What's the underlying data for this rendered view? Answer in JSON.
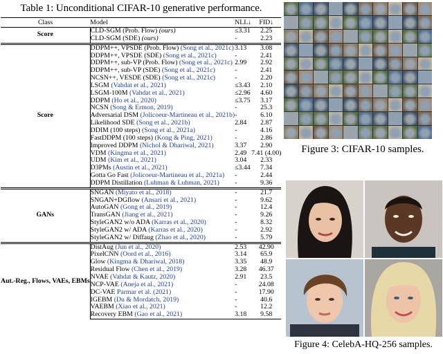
{
  "table_caption": "Table 1: Unconditional CIFAR-10 generative performance.",
  "headers": {
    "class": "Class",
    "model": "Model",
    "nll": "NLL↓",
    "fid": "FID↓"
  },
  "groups": [
    {
      "label": "Score",
      "rows": [
        {
          "model": "CLD-SGM (Prob. Flow) ",
          "suffix": "(ours)",
          "nll": "≤3.31",
          "fid": "2.25"
        },
        {
          "model": "CLD-SGM (SDE) ",
          "suffix": "(ours)",
          "nll": "-",
          "fid": "2.23"
        }
      ]
    },
    {
      "label": "Score",
      "rows": [
        {
          "model": "DDPM++, VPSDE (Prob. Flow) ",
          "cite": "(Song et al., 2021c)",
          "nll": "3.13",
          "fid": "3.08"
        },
        {
          "model": "DDPM++, VPSDE (SDE) ",
          "cite": "(Song et al., 2021c)",
          "nll": "-",
          "fid": "2.41"
        },
        {
          "model": "DDPM++, sub-VP (Prob. Flow) ",
          "cite": "(Song et al., 2021c)",
          "nll": "2.99",
          "fid": "2.92"
        },
        {
          "model": "DDPM++, sub-VP (SDE) ",
          "cite": "(Song et al., 2021c)",
          "nll": "-",
          "fid": "2.41"
        },
        {
          "model": "NCSN++, VESDE (SDE) ",
          "cite": "(Song et al., 2021c)",
          "nll": "-",
          "fid": "2.20"
        },
        {
          "model": "LSGM ",
          "cite": "(Vahdat et al., 2021)",
          "nll": "≤3.43",
          "fid": "2.10"
        },
        {
          "model": "LSGM-100M ",
          "cite": "(Vahdat et al., 2021)",
          "nll": "≤2.96",
          "fid": "4.60"
        },
        {
          "model": "DDPM ",
          "cite": "(Ho et al., 2020)",
          "nll": "≤3.75",
          "fid": "3.17"
        },
        {
          "model": "NCSN ",
          "cite": "(Song & Ermon, 2019)",
          "nll": "-",
          "fid": "25.3"
        },
        {
          "model": "Adversarial DSM ",
          "cite": "(Jolicoeur-Martineau et al., 2021b)",
          "nll": "-",
          "fid": "6.10"
        },
        {
          "model": "Likelihood SDE ",
          "cite": "(Song et al., 2021b)",
          "nll": "2.84",
          "fid": "2.87"
        },
        {
          "model": "DDIM (100 steps) ",
          "cite": "(Song et al., 2021a)",
          "nll": "-",
          "fid": "4.16"
        },
        {
          "model": "FastDDPM (100 steps) ",
          "cite": "(Kong & Ping, 2021)",
          "nll": "-",
          "fid": "2.86"
        },
        {
          "model": "Improved DDPM ",
          "cite": "(Nichol & Dhariwal, 2021)",
          "nll": "3.37",
          "fid": "2.90"
        },
        {
          "model": "VDM ",
          "cite": "(Kingma et al., 2021)",
          "nll": "2.49",
          "fid": "7.41 (4.00)"
        },
        {
          "model": "UDM ",
          "cite": "(Kim et al., 2021)",
          "nll": "3.04",
          "fid": "2.33"
        },
        {
          "model": "D3PMs ",
          "cite": "(Austin et al., 2021)",
          "nll": "≤3.44",
          "fid": "7.34"
        },
        {
          "model": "Gotta Go Fast ",
          "cite": "(Jolicoeur-Martineau et al., 2021a)",
          "nll": "-",
          "fid": "2.44"
        },
        {
          "model": "DDPM Distillation ",
          "cite": "(Luhman & Luhman, 2021)",
          "nll": "-",
          "fid": "9.36"
        }
      ]
    },
    {
      "label": "GANs",
      "rows": [
        {
          "model": "SNGAN ",
          "cite": "(Miyato et al., 2018)",
          "nll": "-",
          "fid": "21.7"
        },
        {
          "model": "SNGAN+DGflow ",
          "cite": "(Ansari et al., 2021)",
          "nll": "-",
          "fid": "9.62"
        },
        {
          "model": "AutoGAN ",
          "cite": "(Gong et al., 2019)",
          "nll": "-",
          "fid": "12.4"
        },
        {
          "model": "TransGAN ",
          "cite": "(Jiang et al., 2021)",
          "nll": "-",
          "fid": "9.26"
        },
        {
          "model": "StyleGAN2 w/o ADA ",
          "cite": "(Karras et al., 2020)",
          "nll": "-",
          "fid": "8.32"
        },
        {
          "model": "StyleGAN2 w/ ADA ",
          "cite": "(Karras et al., 2020)",
          "nll": "-",
          "fid": "2.92"
        },
        {
          "model": "StyleGAN2 w/ Diffaug ",
          "cite": "(Zhao et al., 2020)",
          "nll": "-",
          "fid": "5.79"
        }
      ]
    },
    {
      "label": "Aut.-Reg., Flows, VAEs, EBMs",
      "rows": [
        {
          "model": "DistAug ",
          "cite": "(Jun et al., 2020)",
          "nll": "2.53",
          "fid": "42.90"
        },
        {
          "model": "PixelCNN ",
          "cite": "(Oord et al., 2016)",
          "nll": "3.14",
          "fid": "65.9"
        },
        {
          "model": "Glow ",
          "cite": "(Kingma & Dhariwal, 2018)",
          "nll": "3.35",
          "fid": "48.9"
        },
        {
          "model": "Residual Flow ",
          "cite": "(Chen et al., 2019)",
          "nll": "3.28",
          "fid": "46.37"
        },
        {
          "model": "NVAE ",
          "cite": "(Vahdat & Kautz, 2020)",
          "nll": "2.91",
          "fid": "23.5"
        },
        {
          "model": "NCP-VAE ",
          "cite": "(Aneja et al., 2021)",
          "nll": "-",
          "fid": "24.08"
        },
        {
          "model": "DC-VAE ",
          "cite": "Parmar et al. (2021)",
          "nll": "-",
          "fid": "17.90"
        },
        {
          "model": "IGEBM ",
          "cite": "(Du & Mordatch, 2019)",
          "nll": "-",
          "fid": "40.6"
        },
        {
          "model": "VAEBM ",
          "cite": "(Xiao et al., 2021)",
          "nll": "-",
          "fid": "12.2"
        },
        {
          "model": "Recovery EBM ",
          "cite": "(Gao et al., 2021)",
          "nll": "3.18",
          "fid": "9.58"
        }
      ]
    }
  ],
  "figure3_caption": "Figure 3: CIFAR-10 samples.",
  "figure4_caption": "Figure 4: CelebA-HQ-256 samples.",
  "colors": {
    "cite": "#1f3f99"
  }
}
